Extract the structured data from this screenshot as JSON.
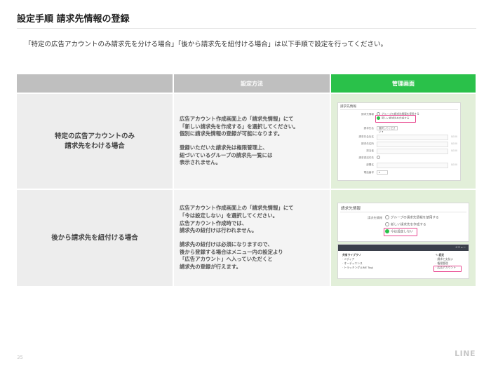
{
  "page": {
    "title": "設定手順 請求先情報の登録",
    "intro": "「特定の広告アカウントのみ請求先を分ける場合」「後から請求先を紐付ける場合」は以下手順で設定を行ってください。",
    "page_number": "35",
    "logo_text": "LINE"
  },
  "table": {
    "headers": {
      "method": "設定方法",
      "admin": "管理画面"
    },
    "rows": [
      {
        "case": "特定の広告アカウントのみ\n請求先をわける場合",
        "method_p1": "広告アカウント作成画面上の「請求先情報」にて\n「新しい請求先を作成する」を選択してください。\n個別に請求先情報の登録が可能になります。",
        "method_p2": "登録いただいた請求先は権限管理上、\n紐づいているグループの請求先一覧には\n表示されません。"
      },
      {
        "case": "後から請求先を紐付ける場合",
        "method_p1": "広告アカウント作成画面上の「請求先情報」にて\n「今は設定しない」を選択してください。\n広告アカウント作成時では、\n請求先の紐付けは行われません。",
        "method_p2": "請求先の紐付けは必須になりますので、\n後から登録する場合はメニュー内の設定より\n「広告アカウント」へ入っていただくと\n請求先の登録が行えます。"
      }
    ]
  },
  "mock1": {
    "title": "請求先情報",
    "label_billing": "請求先情報",
    "opt_group": "グループの請求先情報を使用する",
    "opt_new": "新しい請求先を作成する",
    "label_name": "請求先名",
    "select_value": "選択してください",
    "label_company": "請求先会社名",
    "label_address": "請求先住所",
    "label_person": "担当者",
    "label_opt": "請求書送付先",
    "label_dept": "部署名",
    "label_tel": "電話番号",
    "count_a": "0/100",
    "count_b": "0/100",
    "count_c": "0/100",
    "count_d": "0/100"
  },
  "mock2": {
    "title": "請求先情報",
    "label_billing": "請求先情報",
    "opt_group": "グループの請求先情報を使用する",
    "opt_new": "新しい請求先を作成する",
    "opt_later": "今は設定しない"
  },
  "mock3": {
    "bar_label": "メニュー",
    "lib_head": "共有ライブラリ",
    "lib_items": [
      "メディア",
      "オーディエンス",
      "トラッキング(LINE Tag)"
    ],
    "settings_head": "設定",
    "settings_items": [
      "請求と支払い",
      "権限管理",
      "広告アカウント"
    ]
  },
  "colors": {
    "header_gray": "#bfbfbf",
    "header_green": "#2ac14a",
    "admin_bg": "#e2efd9",
    "highlight": "#e8468f"
  }
}
